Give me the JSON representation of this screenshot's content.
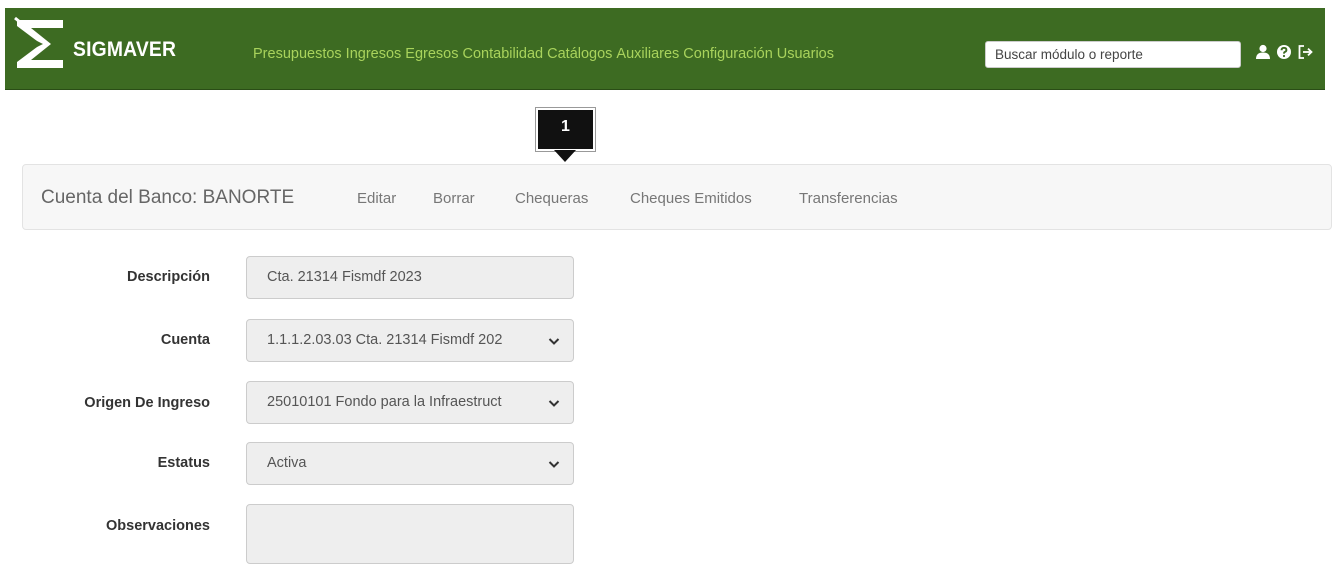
{
  "brand": {
    "name": "SIGMAVER"
  },
  "nav": {
    "items": [
      "Presupuestos",
      "Ingresos",
      "Egresos",
      "Contabilidad",
      "Catálogos",
      "Auxiliares",
      "Configuración",
      "Usuarios"
    ],
    "search_placeholder": "Buscar módulo o reporte",
    "icons": [
      "user-icon",
      "question-icon",
      "logout-icon"
    ]
  },
  "callout": {
    "number": "1"
  },
  "subnav": {
    "title": "Cuenta del Banco: BANORTE",
    "links": [
      "Editar",
      "Borrar",
      "Chequeras",
      "Cheques Emitidos",
      "Transferencias"
    ]
  },
  "form": {
    "descripcion": {
      "label": "Descripción",
      "value": "Cta. 21314 Fismdf 2023"
    },
    "cuenta": {
      "label": "Cuenta",
      "value": "1.1.1.2.03.03 Cta. 21314 Fismdf 202"
    },
    "origen": {
      "label": "Origen De Ingreso",
      "value": "25010101 Fondo para la Infraestruct"
    },
    "estatus": {
      "label": "Estatus",
      "value": "Activa"
    },
    "observaciones": {
      "label": "Observaciones",
      "value": ""
    }
  },
  "colors": {
    "navbar": "#3d6b22",
    "nav_link": "#a9d35c",
    "subnav_bg": "#f7f7f7",
    "field_bg": "#eeeeee"
  }
}
